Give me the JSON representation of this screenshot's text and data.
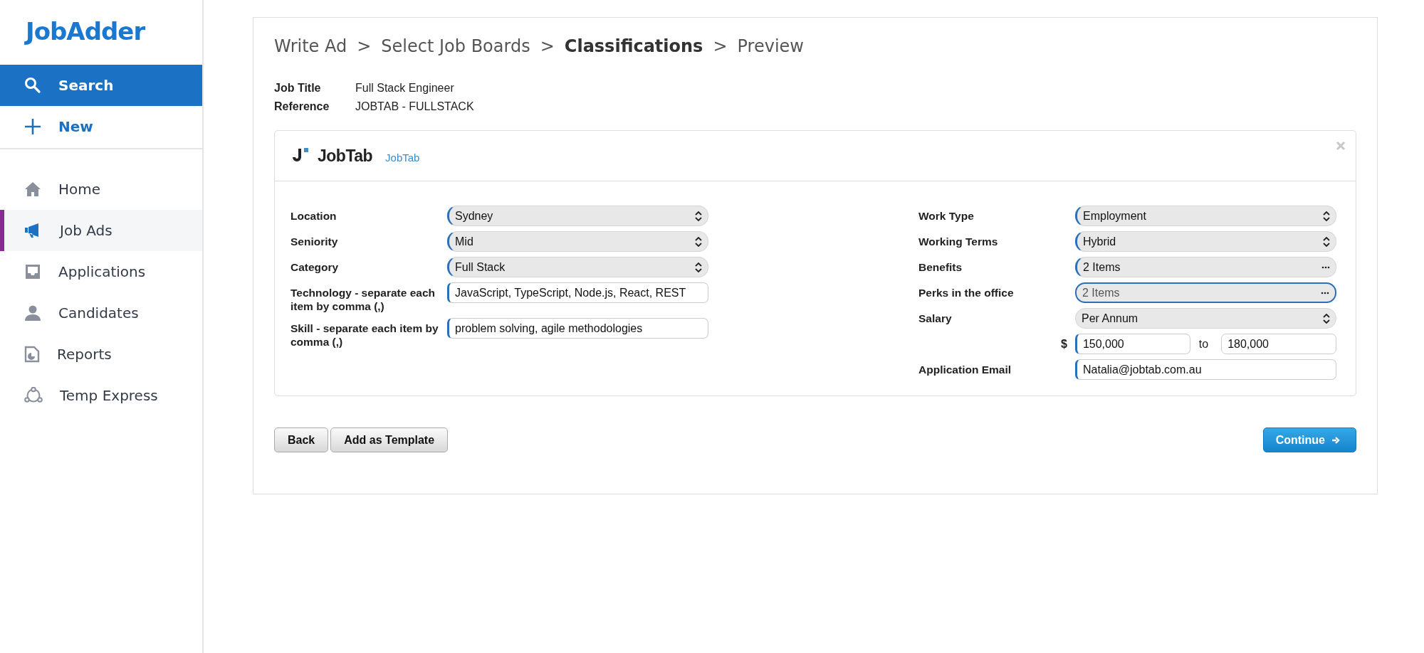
{
  "sidebar": {
    "logo": "JobAdder",
    "actions": [
      {
        "label": "Search",
        "selected": true
      },
      {
        "label": "New",
        "selected": false
      }
    ],
    "items": [
      {
        "label": "Home",
        "selected": false
      },
      {
        "label": "Job Ads",
        "selected": true
      },
      {
        "label": "Applications",
        "selected": false
      },
      {
        "label": "Candidates",
        "selected": false
      },
      {
        "label": "Reports",
        "selected": false
      },
      {
        "label": "Temp Express",
        "selected": false
      }
    ]
  },
  "breadcrumb": [
    {
      "label": "Write Ad",
      "selected": false
    },
    {
      "label": "Select Job Boards",
      "selected": false
    },
    {
      "label": "Classifications",
      "selected": true
    },
    {
      "label": "Preview",
      "selected": false
    }
  ],
  "breadcrumb_separator": ">",
  "summary": [
    {
      "label": "Job Title",
      "value": "Full Stack Engineer"
    },
    {
      "label": "Reference",
      "value": "JOBTAB - FULLSTACK"
    }
  ],
  "board": {
    "logo": "JobTab",
    "link": "JobTab",
    "left_fields": [
      {
        "label": "Location",
        "kind": "select",
        "value": "Sydney",
        "required": true,
        "focused": false
      },
      {
        "label": "Seniority",
        "kind": "select",
        "value": "Mid",
        "required": true,
        "focused": false
      },
      {
        "label": "Category",
        "kind": "select",
        "value": "Full Stack",
        "required": true,
        "focused": false
      },
      {
        "label": "Technology - separate each item by comma (,)",
        "kind": "text",
        "value": "JavaScript, TypeScript, Node.js, React, REST",
        "required": true,
        "focused": false
      },
      {
        "label": "Skill - separate each item by comma (,)",
        "kind": "text",
        "value": "problem solving, agile methodologies",
        "required": true,
        "focused": false
      }
    ],
    "right_fields": [
      {
        "label": "Work Type",
        "kind": "select",
        "value": "Employment",
        "required": true,
        "focused": false
      },
      {
        "label": "Working Terms",
        "kind": "select",
        "value": "Hybrid",
        "required": true,
        "focused": false
      },
      {
        "label": "Benefits",
        "kind": "multi",
        "value": "2 Items",
        "required": true,
        "focused": false
      },
      {
        "label": "Perks in the office",
        "kind": "multi",
        "value": "2 Items",
        "required": true,
        "focused": true
      },
      {
        "label": "Salary",
        "kind": "select",
        "value": "Per Annum",
        "required": false,
        "focused": false
      },
      {
        "kind": "range",
        "currency": "$",
        "from": {
          "value": "150,000",
          "required": true
        },
        "separator": "to",
        "to": {
          "value": "180,000",
          "required": false
        }
      },
      {
        "label": "Application Email",
        "kind": "text",
        "value": "Natalia@jobtab.com.au",
        "required": true,
        "focused": false
      }
    ]
  },
  "buttons": [
    {
      "label": "Back",
      "kind": "secondary"
    },
    {
      "label": "Add as Template",
      "kind": "secondary"
    },
    {
      "label": "Continue",
      "kind": "primary"
    }
  ]
}
